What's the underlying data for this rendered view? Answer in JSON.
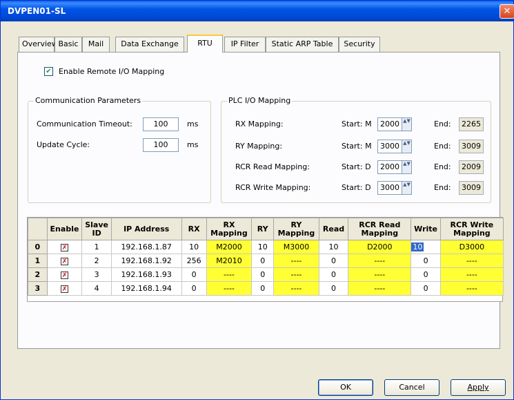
{
  "window": {
    "title": "DVPEN01-SL",
    "close": "✕"
  },
  "tabs": [
    "Overview",
    "Basic",
    "Mail",
    "Data Exchange",
    "RTU",
    "IP Filter",
    "Static ARP Table",
    "Security"
  ],
  "active_tab": "RTU",
  "enable_remote": {
    "label": "Enable Remote I/O Mapping",
    "checked": true,
    "mark": "✔"
  },
  "comm": {
    "legend": "Communication Parameters",
    "timeout_label": "Communication Timeout:",
    "timeout_value": "100",
    "timeout_unit": "ms",
    "cycle_label": "Update Cycle:",
    "cycle_value": "100",
    "cycle_unit": "ms"
  },
  "plc": {
    "legend": "PLC I/O Mapping",
    "rows": [
      {
        "label": "RX Mapping:",
        "start_label": "Start: M",
        "start": "2000",
        "end_label": "End:",
        "end": "2265"
      },
      {
        "label": "RY Mapping:",
        "start_label": "Start: M",
        "start": "3000",
        "end_label": "End:",
        "end": "3009"
      },
      {
        "label": "RCR Read Mapping:",
        "start_label": "Start: D",
        "start": "2000",
        "end_label": "End:",
        "end": "2009"
      },
      {
        "label": "RCR Write Mapping:",
        "start_label": "Start: D",
        "start": "3000",
        "end_label": "End:",
        "end": "3009"
      }
    ]
  },
  "grid": {
    "headers": [
      "",
      "Enable",
      "Slave ID",
      "IP Address",
      "RX",
      "RX Mapping",
      "RY",
      "RY Mapping",
      "Read",
      "RCR Read Mapping",
      "Write",
      "RCR Write Mapping"
    ],
    "rows": [
      {
        "n": "0",
        "slave": "1",
        "ip": "192.168.1.87",
        "rx": "10",
        "rxmap": "M2000",
        "ry": "10",
        "rymap": "M3000",
        "read": "10",
        "readmap": "D2000",
        "write": "10",
        "writemap": "D3000"
      },
      {
        "n": "1",
        "slave": "2",
        "ip": "192.168.1.92",
        "rx": "256",
        "rxmap": "M2010",
        "ry": "0",
        "rymap": "----",
        "read": "0",
        "readmap": "----",
        "write": "0",
        "writemap": "----"
      },
      {
        "n": "2",
        "slave": "3",
        "ip": "192.168.1.93",
        "rx": "0",
        "rxmap": "----",
        "ry": "0",
        "rymap": "----",
        "read": "0",
        "readmap": "----",
        "write": "0",
        "writemap": "----"
      },
      {
        "n": "3",
        "slave": "4",
        "ip": "192.168.1.94",
        "rx": "0",
        "rxmap": "----",
        "ry": "0",
        "rymap": "----",
        "read": "0",
        "readmap": "----",
        "write": "0",
        "writemap": "----"
      }
    ],
    "check_mark": "✗"
  },
  "buttons": {
    "ok": "OK",
    "cancel": "Cancel",
    "apply": "Apply"
  },
  "spin_arrows": "▲▼"
}
